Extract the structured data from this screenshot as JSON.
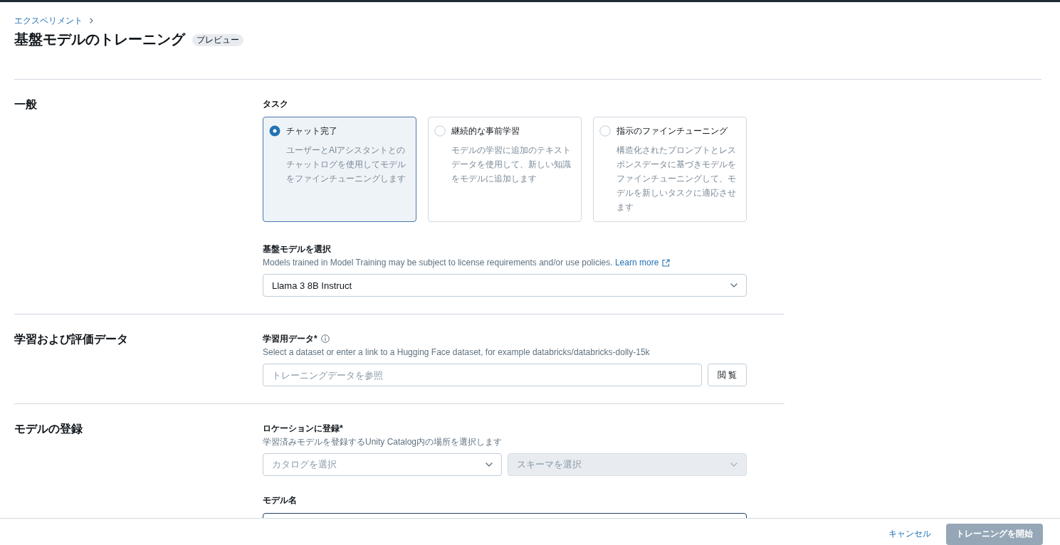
{
  "breadcrumb": [
    "エクスペリメント"
  ],
  "page": {
    "title": "基盤モデルのトレーニング",
    "badge": "プレビュー"
  },
  "sections": [
    {
      "title": "一般",
      "fields": [
        {
          "kind": "cards",
          "label": "タスク",
          "options": [
            {
              "title": "チャット完了",
              "description": "ユーザーとAIアシスタントとのチャットログを使用してモデルをファインチューニングします",
              "selected": true
            },
            {
              "title": "継続的な事前学習",
              "description": "モデルの学習に追加のテキストデータを使用して、新しい知識をモデルに追加します",
              "selected": false
            },
            {
              "title": "指示のファインチューニング",
              "description": "構造化されたプロンプトとレスポンスデータに基づきモデルをファインチューニングして、モデルを新しいタスクに適応させます",
              "selected": false
            }
          ]
        },
        {
          "kind": "select",
          "label": "基盤モデルを選択",
          "hint": "Models trained in Model Training may be subject to license requirements and/or use policies.",
          "link": "Learn more",
          "selects": [
            {
              "value": "Llama 3 8B Instruct",
              "disabled": false
            }
          ]
        }
      ]
    },
    {
      "title": "学習および評価データ",
      "fields": [
        {
          "kind": "browse",
          "label": "学習用データ*",
          "info": true,
          "hint": "Select a dataset or enter a link to a Hugging Face dataset, for example databricks/databricks-dolly-15k",
          "placeholder": "トレーニングデータを参照",
          "button": "閲 覧"
        }
      ]
    },
    {
      "title": "モデルの登録",
      "fields": [
        {
          "kind": "select",
          "label": "ロケーションに登録*",
          "hint": "学習済みモデルを登録するUnity Catalog内の場所を選択します",
          "selects": [
            {
              "placeholder": "カタログを選択",
              "disabled": false
            },
            {
              "placeholder": "スキーマを選択",
              "disabled": true
            }
          ]
        },
        {
          "kind": "text",
          "label": "モデル名",
          "focused": true
        }
      ]
    }
  ],
  "footer": {
    "cancel": "キャンセル",
    "submit": {
      "label": "トレーニングを開始",
      "disabled": true
    }
  }
}
